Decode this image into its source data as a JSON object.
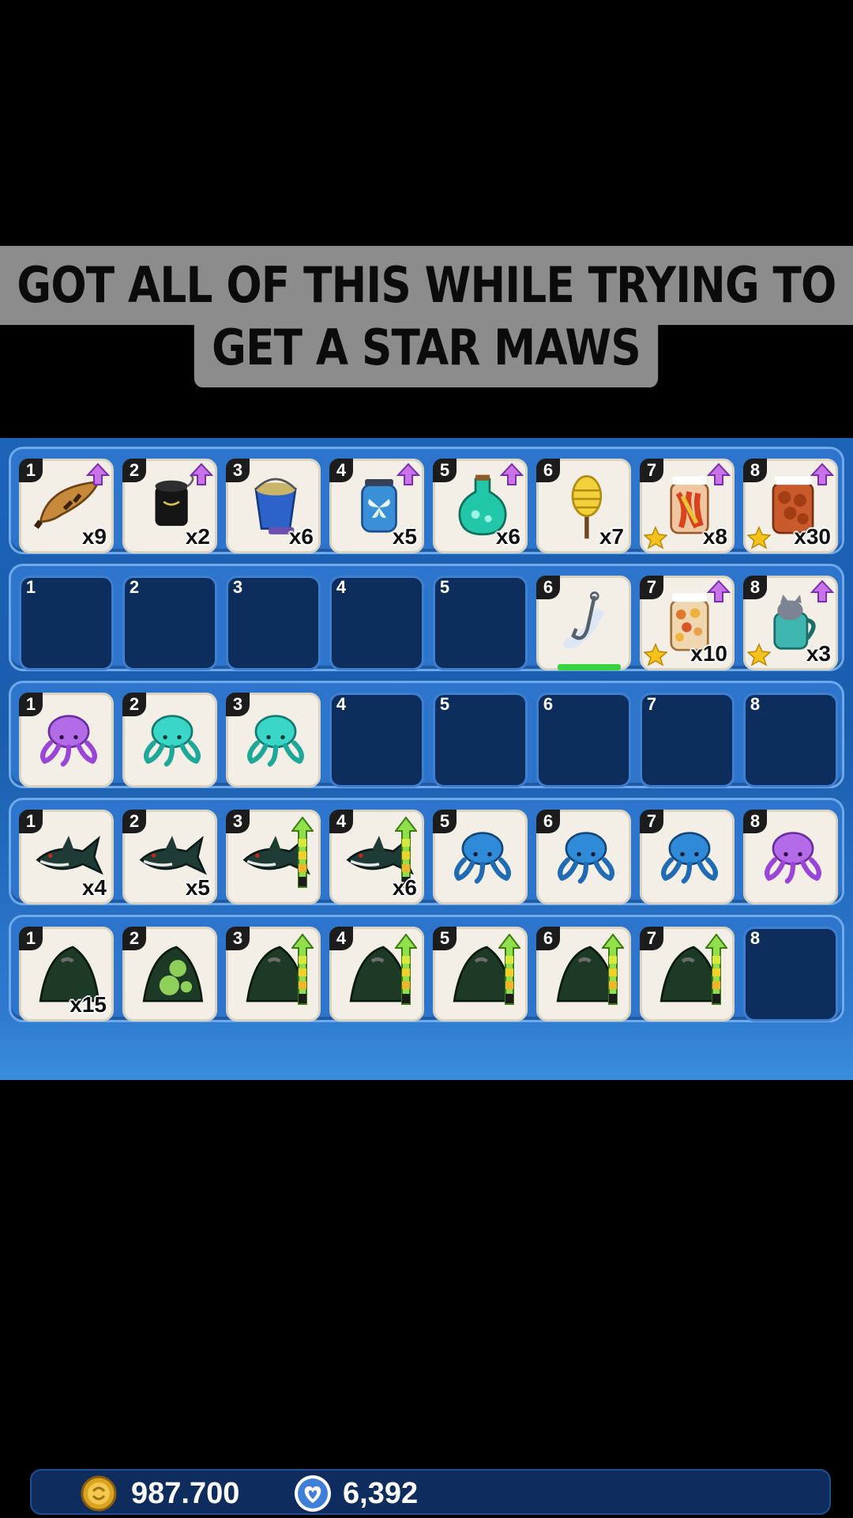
{
  "caption": {
    "line1": "GOT ALL OF THIS WHILE TRYING TO",
    "line2": "GET A STAR MAWS"
  },
  "rows": [
    {
      "slots": [
        {
          "num": "1",
          "icon": "horn-icon",
          "qty": "x9",
          "upgrade": true
        },
        {
          "num": "2",
          "icon": "cannon-icon",
          "qty": "x2",
          "upgrade": true
        },
        {
          "num": "3",
          "icon": "bucket-icon",
          "qty": "x6",
          "upgrade": false
        },
        {
          "num": "4",
          "icon": "butterfly-jar-icon",
          "qty": "x5",
          "upgrade": true
        },
        {
          "num": "5",
          "icon": "potion-icon",
          "qty": "x6",
          "upgrade": true
        },
        {
          "num": "6",
          "icon": "honey-dipper-icon",
          "qty": "x7",
          "upgrade": false
        },
        {
          "num": "7",
          "icon": "pickle-jar-icon",
          "qty": "x8",
          "upgrade": true,
          "star": true
        },
        {
          "num": "8",
          "icon": "meatball-jar-icon",
          "qty": "x30",
          "upgrade": true,
          "star": true
        }
      ]
    },
    {
      "slots": [
        {
          "num": "1",
          "empty": true
        },
        {
          "num": "2",
          "empty": true
        },
        {
          "num": "3",
          "empty": true
        },
        {
          "num": "4",
          "empty": true
        },
        {
          "num": "5",
          "empty": true
        },
        {
          "num": "6",
          "icon": "fishing-hook-icon",
          "qty": "",
          "progress": true
        },
        {
          "num": "7",
          "icon": "snack-jar-icon",
          "qty": "x10",
          "upgrade": true,
          "star": true
        },
        {
          "num": "8",
          "icon": "cat-mug-icon",
          "qty": "x3",
          "upgrade": true,
          "star": true
        }
      ]
    },
    {
      "slots": [
        {
          "num": "1",
          "icon": "purple-jellyfish-icon",
          "qty": ""
        },
        {
          "num": "2",
          "icon": "teal-jellyfish-icon",
          "qty": ""
        },
        {
          "num": "3",
          "icon": "teal-jellyfish-icon",
          "qty": ""
        },
        {
          "num": "4",
          "empty": true
        },
        {
          "num": "5",
          "empty": true
        },
        {
          "num": "6",
          "empty": true
        },
        {
          "num": "7",
          "empty": true
        },
        {
          "num": "8",
          "empty": true
        }
      ]
    },
    {
      "slots": [
        {
          "num": "1",
          "icon": "shark-icon",
          "qty": "x4"
        },
        {
          "num": "2",
          "icon": "shark-icon",
          "qty": "x5"
        },
        {
          "num": "3",
          "icon": "shark-icon",
          "qty": "",
          "ladder": true
        },
        {
          "num": "4",
          "icon": "shark-icon",
          "qty": "x6",
          "ladder": true
        },
        {
          "num": "5",
          "icon": "blue-jellyfish-icon",
          "qty": ""
        },
        {
          "num": "6",
          "icon": "blue-jellyfish-icon",
          "qty": ""
        },
        {
          "num": "7",
          "icon": "blue-jellyfish-icon",
          "qty": ""
        },
        {
          "num": "8",
          "icon": "purple-jellyfish-icon",
          "qty": ""
        }
      ]
    },
    {
      "slots": [
        {
          "num": "1",
          "icon": "seaweed-rock-icon",
          "qty": "x15"
        },
        {
          "num": "2",
          "icon": "mossy-rock-icon",
          "qty": ""
        },
        {
          "num": "3",
          "icon": "seaweed-rock-icon",
          "qty": "",
          "ladder": true
        },
        {
          "num": "4",
          "icon": "seaweed-rock-icon",
          "qty": "",
          "ladder": true
        },
        {
          "num": "5",
          "icon": "seaweed-rock-icon",
          "qty": "",
          "ladder": true
        },
        {
          "num": "6",
          "icon": "seaweed-rock-icon",
          "qty": "",
          "ladder": true
        },
        {
          "num": "7",
          "icon": "seaweed-rock-icon",
          "qty": "",
          "ladder": true
        },
        {
          "num": "8",
          "empty": true
        }
      ]
    }
  ],
  "currency": {
    "coins": "987.700",
    "hearts": "6,392"
  },
  "colors": {
    "panel_blue": "#1d63b8",
    "slot_bg": "#f3efe6",
    "empty_slot": "#0d2d5c",
    "upgrade_arrow": "#c874e8",
    "ladder_arrow": "#8fe04a",
    "star": "#f4c21b"
  }
}
